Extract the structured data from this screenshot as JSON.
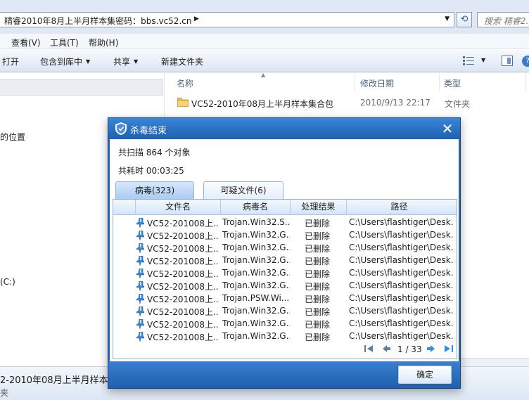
{
  "address_bar": {
    "path": "精睿2010年8月上半月样本集密码：bbs.vc52.cn",
    "search_placeholder": "搜索 精睿2..."
  },
  "menu": [
    "查看(V)",
    "工具(T)",
    "帮助(H)"
  ],
  "toolbar": {
    "open": "打开",
    "include_in_library": "包含到库中",
    "share": "共享",
    "new_folder": "新建文件夹"
  },
  "nav_pane": {
    "locations_label": "的位置",
    "drive_label": "(C:)"
  },
  "columns": {
    "name": "名称",
    "modified": "修改日期",
    "type": "类型"
  },
  "file": {
    "name": "VC52-2010年08月上半月样本集合包",
    "modified": "2010/9/13 22:17",
    "type": "文件夹"
  },
  "status": {
    "name": "2-2010年08月上半月样本",
    "type": "夹"
  },
  "dialog": {
    "title": "杀毒结束",
    "scanned": "共扫描 864 个对象",
    "elapsed": "共耗时 00:03:25",
    "tabs": [
      "病毒(323)",
      "可疑文件(6)"
    ],
    "headers": [
      "文件名",
      "病毒名",
      "处理结果",
      "路径"
    ],
    "rows": [
      [
        "VC52-201008上...",
        "Trojan.Win32.S...",
        "已删除",
        "C:\\Users\\flashtiger\\Desk..."
      ],
      [
        "VC52-201008上...",
        "Trojan.Win32.G...",
        "已删除",
        "C:\\Users\\flashtiger\\Desk..."
      ],
      [
        "VC52-201008上...",
        "Trojan.Win32.G...",
        "已删除",
        "C:\\Users\\flashtiger\\Desk..."
      ],
      [
        "VC52-201008上...",
        "Trojan.Win32.G...",
        "已删除",
        "C:\\Users\\flashtiger\\Desk..."
      ],
      [
        "VC52-201008上...",
        "Trojan.Win32.G...",
        "已删除",
        "C:\\Users\\flashtiger\\Desk..."
      ],
      [
        "VC52-201008上...",
        "Trojan.Win32.G...",
        "已删除",
        "C:\\Users\\flashtiger\\Desk..."
      ],
      [
        "VC52-201008上...",
        "Trojan.PSW.Wi...",
        "已删除",
        "C:\\Users\\flashtiger\\Desk..."
      ],
      [
        "VC52-201008上...",
        "Trojan.Win32.G...",
        "已删除",
        "C:\\Users\\flashtiger\\Desk..."
      ],
      [
        "VC52-201008上...",
        "Trojan.Win32.G...",
        "已删除",
        "C:\\Users\\flashtiger\\Desk..."
      ],
      [
        "VC52-201008上...",
        "Trojan.Win32.G...",
        "已删除",
        "C:\\Users\\flashtiger\\Desk..."
      ]
    ],
    "pager": "1 / 33",
    "ok": "确定"
  }
}
